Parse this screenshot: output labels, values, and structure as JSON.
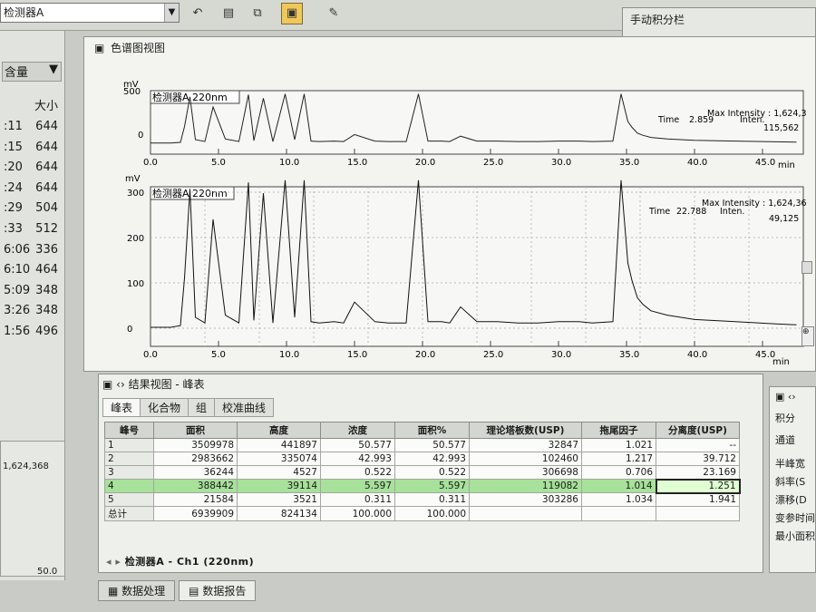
{
  "toolbar": {
    "detector_select": "检测器A"
  },
  "left_panel": {
    "header_label": "含量",
    "col_header": "大小",
    "rows": [
      {
        "time": ":11",
        "size": "644"
      },
      {
        "time": ":15",
        "size": "644"
      },
      {
        "time": ":20",
        "size": "644"
      },
      {
        "time": ":24",
        "size": "644"
      },
      {
        "time": ":29",
        "size": "504"
      },
      {
        "time": ":33",
        "size": "512"
      },
      {
        "time": "6:06",
        "size": "336"
      },
      {
        "time": "6:10",
        "size": "464"
      },
      {
        "time": "5:09",
        "size": "348"
      },
      {
        "time": "3:26",
        "size": "348"
      },
      {
        "time": "1:56",
        "size": "496"
      }
    ],
    "bottom_value": "1,624,368",
    "bottom_axis": "50.0"
  },
  "manual_integration": {
    "title": "手动积分栏"
  },
  "chrom_view": {
    "title": "色谱图视图",
    "unit_label": "mV",
    "min_label": "min",
    "x_ticks": [
      "0.0",
      "5.0",
      "10.0",
      "15.0",
      "20.0",
      "25.0",
      "30.0",
      "35.0",
      "40.0",
      "45.0"
    ],
    "top_chart": {
      "detector_label": "检测器A 220nm",
      "max_intensity": "Max Intensity : 1,624,368",
      "time_label": "Time",
      "time_value": "2.859",
      "inten_label": "Inten.",
      "inten_value": "115,562",
      "y_ticks": [
        "500",
        "0"
      ]
    },
    "main_chart": {
      "detector_label": "检测器A 220nm",
      "max_intensity": "Max Intensity : 1,624,368",
      "time_label": "Time",
      "time_value": "22.788",
      "inten_label": "Inten.",
      "inten_value": "49,125",
      "y_ticks": [
        "300",
        "200",
        "100",
        "0"
      ]
    }
  },
  "chart_data": {
    "type": "line",
    "xlabel": "min",
    "ylabel": "mV",
    "xlim": [
      0,
      48
    ],
    "ylim": [
      -10,
      350
    ],
    "series": [
      {
        "x": [
          0,
          1.5,
          2.2,
          2.5,
          2.9,
          3.3,
          4.0,
          4.6,
          5.5,
          6.5,
          7.2,
          7.6,
          8.3,
          9.0,
          9.9,
          10.6,
          11.3,
          11.8,
          12.4,
          13.5,
          14.2,
          15.0,
          16.5,
          17.5,
          18.3,
          18.8,
          19.7,
          20.4,
          21.4,
          22.0,
          22.8,
          24.0,
          25.5,
          27.0,
          28.5,
          30.0,
          31.5,
          32.5,
          34.0,
          34.6,
          35.1,
          35.4,
          35.8,
          36.2,
          36.8,
          38.0,
          40.0,
          43.0,
          46.0,
          47.5
        ],
        "y": [
          2,
          2,
          6,
          115,
          320,
          25,
          12,
          250,
          30,
          12,
          335,
          18,
          310,
          12,
          340,
          25,
          340,
          15,
          12,
          15,
          12,
          60,
          15,
          12,
          12,
          12,
          340,
          15,
          15,
          12,
          49,
          15,
          15,
          12,
          12,
          15,
          15,
          12,
          15,
          340,
          150,
          110,
          70,
          55,
          40,
          30,
          20,
          15,
          10,
          8
        ]
      }
    ],
    "notes": "Minimap overview above main chromatogram shows same trace."
  },
  "results": {
    "title": "结果视图 - 峰表",
    "tabs": [
      "峰表",
      "化合物",
      "组",
      "校准曲线"
    ],
    "columns": [
      "峰号",
      "面积",
      "高度",
      "浓度",
      "面积%",
      "理论塔板数(USP)",
      "拖尾因子",
      "分离度(USP)"
    ],
    "rows": [
      {
        "no": "1",
        "area": "3509978",
        "height": "441897",
        "conc": "50.577",
        "area_pct": "50.577",
        "plates": "32847",
        "tailing": "1.021",
        "res": "--"
      },
      {
        "no": "2",
        "area": "2983662",
        "height": "335074",
        "conc": "42.993",
        "area_pct": "42.993",
        "plates": "102460",
        "tailing": "1.217",
        "res": "39.712"
      },
      {
        "no": "3",
        "area": "36244",
        "height": "4527",
        "conc": "0.522",
        "area_pct": "0.522",
        "plates": "306698",
        "tailing": "0.706",
        "res": "23.169"
      },
      {
        "no": "4",
        "area": "388442",
        "height": "39114",
        "conc": "5.597",
        "area_pct": "5.597",
        "plates": "119082",
        "tailing": "1.014",
        "res": "1.251"
      },
      {
        "no": "5",
        "area": "21584",
        "height": "3521",
        "conc": "0.311",
        "area_pct": "0.311",
        "plates": "303286",
        "tailing": "1.034",
        "res": "1.941"
      }
    ],
    "total": {
      "label": "总计",
      "area": "6939909",
      "height": "824134",
      "conc": "100.000",
      "area_pct": "100.000"
    },
    "channel_tab": "检测器A - Ch1 (220nm)"
  },
  "right_panel": {
    "items": [
      "积分",
      "通道",
      "半峰宽",
      "斜率(S",
      "漂移(D",
      "变参时间",
      "最小面积"
    ]
  },
  "bottom_tabs": [
    "数据处理",
    "数据报告"
  ]
}
